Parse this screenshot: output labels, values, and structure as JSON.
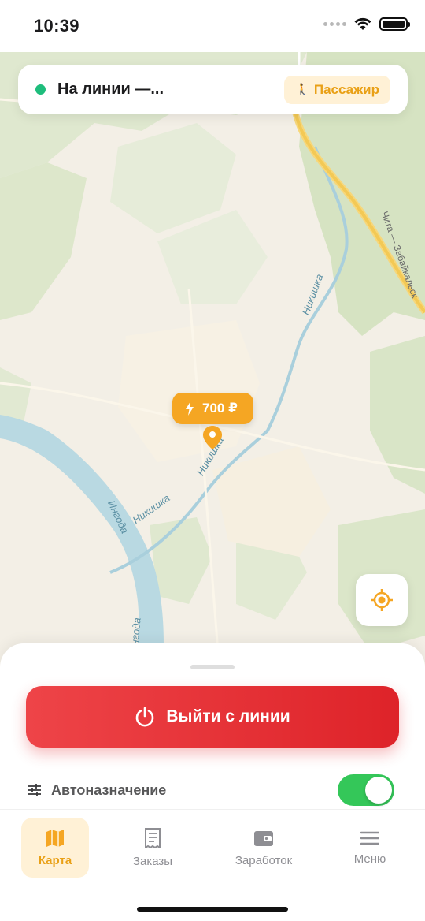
{
  "status_bar": {
    "time": "10:39"
  },
  "top_card": {
    "line_status": "На линии —...",
    "passenger_label": "Пассажир",
    "online_color": "#1ebd7c"
  },
  "map": {
    "price_marker": "700 ₽",
    "river_label_1": "Никишка",
    "river_label_2": "Никишка",
    "river_label_3": "Никишка",
    "river_label_4": "Ингода",
    "river_label_5": "Ингода",
    "road_label": "Чита — Забайкальск"
  },
  "sheet": {
    "go_offline_label": "Выйти с линии",
    "auto_assign_label": "Автоназначение",
    "auto_assign_enabled": true
  },
  "tabs": [
    {
      "label": "Карта",
      "icon": "map-icon",
      "active": true
    },
    {
      "label": "Заказы",
      "icon": "receipt-icon",
      "active": false
    },
    {
      "label": "Заработок",
      "icon": "wallet-icon",
      "active": false
    },
    {
      "label": "Меню",
      "icon": "menu-icon",
      "active": false
    }
  ],
  "colors": {
    "accent": "#f5a623",
    "danger": "#e0292e",
    "success": "#34c759"
  }
}
